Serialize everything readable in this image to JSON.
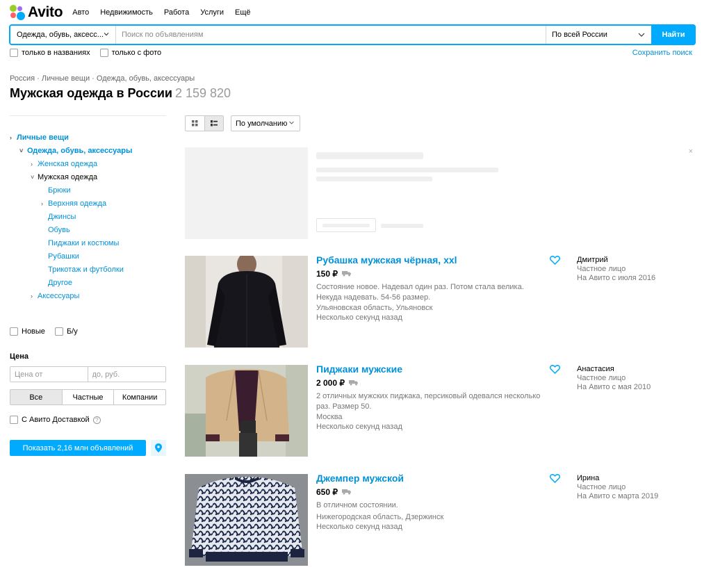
{
  "header": {
    "logo_text": "Avito",
    "nav": [
      "Авто",
      "Недвижимость",
      "Работа",
      "Услуги",
      "Ещё"
    ]
  },
  "search": {
    "category": "Одежда, обувь, аксесс...",
    "placeholder": "Поиск по объявлениям",
    "region": "По всей России",
    "submit": "Найти",
    "only_titles": "только в названиях",
    "only_photo": "только с фото",
    "save": "Сохранить поиск"
  },
  "breadcrumbs": "Россия · Личные вещи · Одежда, обувь, аксессуары",
  "page": {
    "title": "Мужская одежда в России",
    "count": "2 159 820"
  },
  "sidebar": {
    "tree": [
      {
        "label": "Личные вещи",
        "arrow": "›",
        "level": 0,
        "bold": true
      },
      {
        "label": "Одежда, обувь, аксессуары",
        "arrow": "˅",
        "level": 1,
        "bold": true
      },
      {
        "label": "Женская одежда",
        "arrow": "›",
        "level": 2
      },
      {
        "label": "Мужская одежда",
        "arrow": "˅",
        "level": 2,
        "active": true
      },
      {
        "label": "Брюки",
        "arrow": "",
        "level": 3
      },
      {
        "label": "Верхняя одежда",
        "arrow": "›",
        "level": 3
      },
      {
        "label": "Джинсы",
        "arrow": "",
        "level": 3
      },
      {
        "label": "Обувь",
        "arrow": "",
        "level": 3
      },
      {
        "label": "Пиджаки и костюмы",
        "arrow": "",
        "level": 3
      },
      {
        "label": "Рубашки",
        "arrow": "",
        "level": 3
      },
      {
        "label": "Трикотаж и футболки",
        "arrow": "",
        "level": 3
      },
      {
        "label": "Другое",
        "arrow": "",
        "level": 3
      },
      {
        "label": "Аксессуары",
        "arrow": "›",
        "level": 2
      }
    ],
    "cond_new": "Новые",
    "cond_used": "Б/у",
    "price_label": "Цена",
    "price_from": "Цена от",
    "price_to": "до, руб.",
    "seller_types": [
      "Все",
      "Частные",
      "Компании"
    ],
    "seller_selected": "Все",
    "delivery": "С Авито Доставкой",
    "help": "?",
    "show_button": "Показать 2,16 млн объявлений"
  },
  "toolbar": {
    "sort": "По умолчанию"
  },
  "ad": {
    "close": "×"
  },
  "listings": [
    {
      "title": "Рубашка мужская чёрная, xxl",
      "price": "150 ₽",
      "description": "Состояние новое. Надевал один раз. Потом стала велика. Некуда надевать. 54-56 размер.",
      "location": "Ульяновская область, Ульяновск",
      "time": "Несколько секунд назад",
      "seller": "Дмитрий",
      "seller_type": "Частное лицо",
      "since": "На Авито с июля 2016"
    },
    {
      "title": "Пиджаки мужские",
      "price": "2 000 ₽",
      "description": "2 отличных мужских пиджака, персиковый одевался несколько раз. Размер 50.",
      "location": "Москва",
      "time": "Несколько секунд назад",
      "seller": "Анастасия",
      "seller_type": "Частное лицо",
      "since": "На Авито с мая 2010"
    },
    {
      "title": "Джемпер мужской",
      "price": "650 ₽",
      "description": "В отличном состоянии.",
      "location": "Нижегородская область, Дзержинск",
      "time": "Несколько секунд назад",
      "seller": "Ирина",
      "seller_type": "Частное лицо",
      "since": "На Авито с марта 2019"
    }
  ],
  "colors": {
    "accent": "#00aaff",
    "link": "#0091d9"
  },
  "icons": {
    "category_chevron": "chevron-down-icon",
    "region_chevron": "chevron-down-icon",
    "favorite": "heart-outline-icon",
    "delivery": "truck-icon",
    "map": "map-pin-icon",
    "view_grid": "grid-view-icon",
    "view_list": "list-view-icon"
  }
}
